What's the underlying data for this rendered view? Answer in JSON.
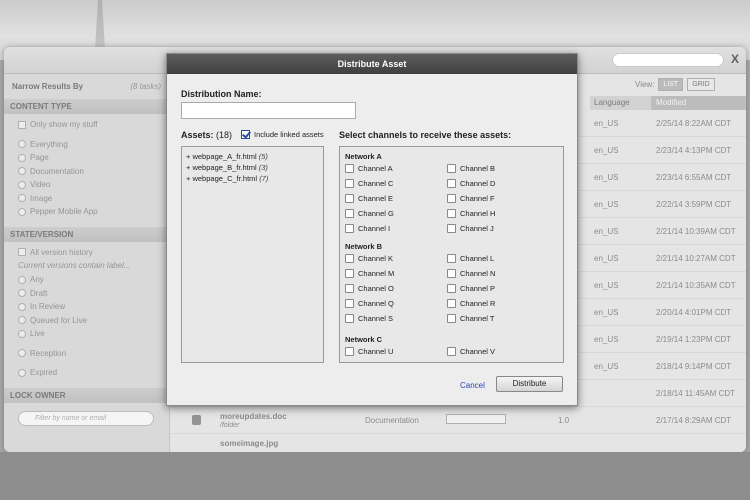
{
  "app": {
    "close_label": "X",
    "sidebar": {
      "title": "Narrow Results By",
      "count": "(8 tasks)",
      "content_type": {
        "heading": "CONTENT TYPE",
        "only_mine": "Only show my stuff",
        "options": [
          "Everything",
          "Page",
          "Documentation",
          "Video",
          "Image",
          "Pepper Mobile App"
        ]
      },
      "state_version": {
        "heading": "STATE/VERSION",
        "all_history": "All version history",
        "label_hint": "Current versions contain label...",
        "options": [
          "Any",
          "Draft",
          "In Review",
          "Queued for Live",
          "Live",
          "Reception",
          "Expired"
        ]
      },
      "lock_owner": {
        "heading": "LOCK OWNER",
        "filter_placeholder": "Filter by name or email"
      }
    },
    "main": {
      "view_label": "View:",
      "list_label": "LIST",
      "grid_label": "GRID",
      "columns": {
        "language": "Language",
        "modified": "Modified"
      },
      "rows": [
        {
          "lang": "en_US",
          "modified": "2/25/14 8:22AM CDT"
        },
        {
          "lang": "en_US",
          "modified": "2/23/14 4:13PM CDT"
        },
        {
          "lang": "en_US",
          "modified": "2/23/14 6:55AM CDT"
        },
        {
          "lang": "en_US",
          "modified": "2/22/14 3:59PM CDT"
        },
        {
          "lang": "en_US",
          "modified": "2/21/14 10:39AM CDT"
        },
        {
          "lang": "en_US",
          "modified": "2/21/14 10:27AM CDT"
        },
        {
          "lang": "en_US",
          "modified": "2/21/14 10:35AM CDT"
        },
        {
          "lang": "en_US",
          "modified": "2/20/14 4:01PM CDT"
        },
        {
          "lang": "en_US",
          "modified": "2/19/14 1:23PM CDT"
        },
        {
          "lang": "en_US",
          "modified": "2/18/14 9:14PM CDT"
        },
        {
          "lang": "",
          "modified": "2/18/14 11:45AM CDT"
        },
        {
          "lang": "",
          "modified": "2/17/14 8:29AM CDT",
          "name": "moreupdates.doc",
          "folder": "/folder",
          "type": "Documentation",
          "version": "1.0"
        },
        {
          "lang": "",
          "modified": "",
          "name": "someimage.jpg"
        }
      ]
    }
  },
  "dialog": {
    "title": "Distribute Asset",
    "name_label": "Distribution Name:",
    "name_value": "",
    "assets_label": "Assets:",
    "assets_count": "(18)",
    "include_linked": "Include linked assets",
    "channels_label": "Select channels to receive these assets:",
    "assets": [
      {
        "name": "+ webpage_A_fr.html",
        "count": "(5)"
      },
      {
        "name": "+ webpage_B_fr.html",
        "count": "(3)"
      },
      {
        "name": "+ webpage_C_fr.html",
        "count": "(7)"
      }
    ],
    "networks": [
      {
        "name": "Network A",
        "channels": [
          "Channel A",
          "Channel B",
          "Channel C",
          "Channel D",
          "Channel E",
          "Channel F",
          "Channel G",
          "Channel H",
          "Channel I",
          "Channel J"
        ]
      },
      {
        "name": "Network B",
        "channels": [
          "Channel K",
          "Channel L",
          "Channel M",
          "Channel N",
          "Channel O",
          "Channel P",
          "Channel Q",
          "Channel R",
          "Channel S",
          "Channel T"
        ]
      },
      {
        "name": "Network C",
        "channels": [
          "Channel U",
          "Channel V"
        ]
      }
    ],
    "cancel_label": "Cancel",
    "distribute_label": "Distribute"
  }
}
